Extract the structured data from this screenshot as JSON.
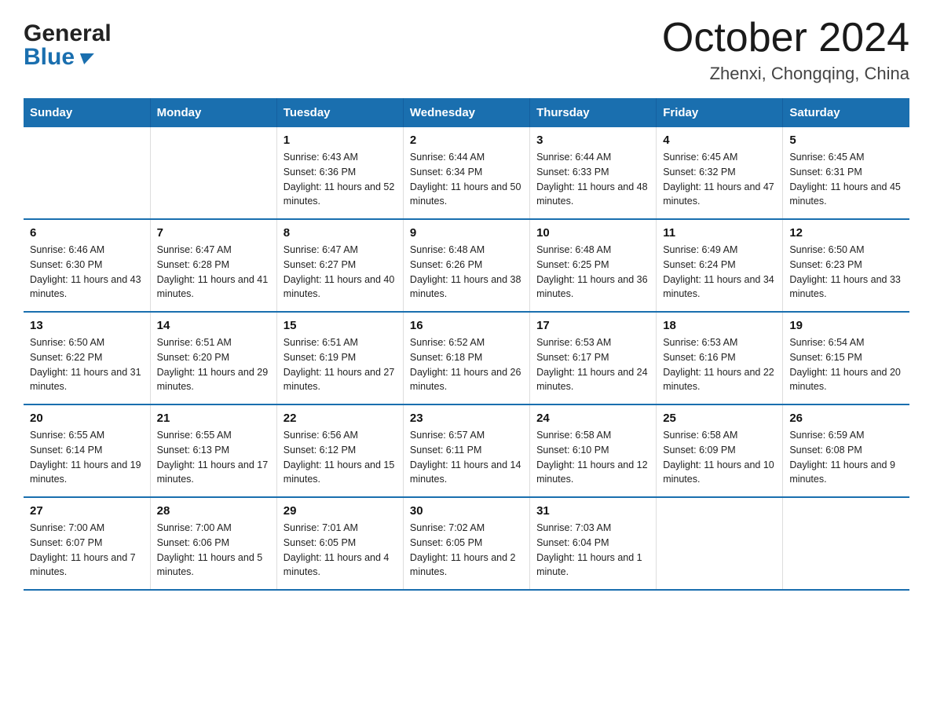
{
  "logo": {
    "line1": "General",
    "line2": "Blue"
  },
  "title": "October 2024",
  "subtitle": "Zhenxi, Chongqing, China",
  "weekdays": [
    "Sunday",
    "Monday",
    "Tuesday",
    "Wednesday",
    "Thursday",
    "Friday",
    "Saturday"
  ],
  "weeks": [
    [
      {
        "day": "",
        "sunrise": "",
        "sunset": "",
        "daylight": ""
      },
      {
        "day": "",
        "sunrise": "",
        "sunset": "",
        "daylight": ""
      },
      {
        "day": "1",
        "sunrise": "Sunrise: 6:43 AM",
        "sunset": "Sunset: 6:36 PM",
        "daylight": "Daylight: 11 hours and 52 minutes."
      },
      {
        "day": "2",
        "sunrise": "Sunrise: 6:44 AM",
        "sunset": "Sunset: 6:34 PM",
        "daylight": "Daylight: 11 hours and 50 minutes."
      },
      {
        "day": "3",
        "sunrise": "Sunrise: 6:44 AM",
        "sunset": "Sunset: 6:33 PM",
        "daylight": "Daylight: 11 hours and 48 minutes."
      },
      {
        "day": "4",
        "sunrise": "Sunrise: 6:45 AM",
        "sunset": "Sunset: 6:32 PM",
        "daylight": "Daylight: 11 hours and 47 minutes."
      },
      {
        "day": "5",
        "sunrise": "Sunrise: 6:45 AM",
        "sunset": "Sunset: 6:31 PM",
        "daylight": "Daylight: 11 hours and 45 minutes."
      }
    ],
    [
      {
        "day": "6",
        "sunrise": "Sunrise: 6:46 AM",
        "sunset": "Sunset: 6:30 PM",
        "daylight": "Daylight: 11 hours and 43 minutes."
      },
      {
        "day": "7",
        "sunrise": "Sunrise: 6:47 AM",
        "sunset": "Sunset: 6:28 PM",
        "daylight": "Daylight: 11 hours and 41 minutes."
      },
      {
        "day": "8",
        "sunrise": "Sunrise: 6:47 AM",
        "sunset": "Sunset: 6:27 PM",
        "daylight": "Daylight: 11 hours and 40 minutes."
      },
      {
        "day": "9",
        "sunrise": "Sunrise: 6:48 AM",
        "sunset": "Sunset: 6:26 PM",
        "daylight": "Daylight: 11 hours and 38 minutes."
      },
      {
        "day": "10",
        "sunrise": "Sunrise: 6:48 AM",
        "sunset": "Sunset: 6:25 PM",
        "daylight": "Daylight: 11 hours and 36 minutes."
      },
      {
        "day": "11",
        "sunrise": "Sunrise: 6:49 AM",
        "sunset": "Sunset: 6:24 PM",
        "daylight": "Daylight: 11 hours and 34 minutes."
      },
      {
        "day": "12",
        "sunrise": "Sunrise: 6:50 AM",
        "sunset": "Sunset: 6:23 PM",
        "daylight": "Daylight: 11 hours and 33 minutes."
      }
    ],
    [
      {
        "day": "13",
        "sunrise": "Sunrise: 6:50 AM",
        "sunset": "Sunset: 6:22 PM",
        "daylight": "Daylight: 11 hours and 31 minutes."
      },
      {
        "day": "14",
        "sunrise": "Sunrise: 6:51 AM",
        "sunset": "Sunset: 6:20 PM",
        "daylight": "Daylight: 11 hours and 29 minutes."
      },
      {
        "day": "15",
        "sunrise": "Sunrise: 6:51 AM",
        "sunset": "Sunset: 6:19 PM",
        "daylight": "Daylight: 11 hours and 27 minutes."
      },
      {
        "day": "16",
        "sunrise": "Sunrise: 6:52 AM",
        "sunset": "Sunset: 6:18 PM",
        "daylight": "Daylight: 11 hours and 26 minutes."
      },
      {
        "day": "17",
        "sunrise": "Sunrise: 6:53 AM",
        "sunset": "Sunset: 6:17 PM",
        "daylight": "Daylight: 11 hours and 24 minutes."
      },
      {
        "day": "18",
        "sunrise": "Sunrise: 6:53 AM",
        "sunset": "Sunset: 6:16 PM",
        "daylight": "Daylight: 11 hours and 22 minutes."
      },
      {
        "day": "19",
        "sunrise": "Sunrise: 6:54 AM",
        "sunset": "Sunset: 6:15 PM",
        "daylight": "Daylight: 11 hours and 20 minutes."
      }
    ],
    [
      {
        "day": "20",
        "sunrise": "Sunrise: 6:55 AM",
        "sunset": "Sunset: 6:14 PM",
        "daylight": "Daylight: 11 hours and 19 minutes."
      },
      {
        "day": "21",
        "sunrise": "Sunrise: 6:55 AM",
        "sunset": "Sunset: 6:13 PM",
        "daylight": "Daylight: 11 hours and 17 minutes."
      },
      {
        "day": "22",
        "sunrise": "Sunrise: 6:56 AM",
        "sunset": "Sunset: 6:12 PM",
        "daylight": "Daylight: 11 hours and 15 minutes."
      },
      {
        "day": "23",
        "sunrise": "Sunrise: 6:57 AM",
        "sunset": "Sunset: 6:11 PM",
        "daylight": "Daylight: 11 hours and 14 minutes."
      },
      {
        "day": "24",
        "sunrise": "Sunrise: 6:58 AM",
        "sunset": "Sunset: 6:10 PM",
        "daylight": "Daylight: 11 hours and 12 minutes."
      },
      {
        "day": "25",
        "sunrise": "Sunrise: 6:58 AM",
        "sunset": "Sunset: 6:09 PM",
        "daylight": "Daylight: 11 hours and 10 minutes."
      },
      {
        "day": "26",
        "sunrise": "Sunrise: 6:59 AM",
        "sunset": "Sunset: 6:08 PM",
        "daylight": "Daylight: 11 hours and 9 minutes."
      }
    ],
    [
      {
        "day": "27",
        "sunrise": "Sunrise: 7:00 AM",
        "sunset": "Sunset: 6:07 PM",
        "daylight": "Daylight: 11 hours and 7 minutes."
      },
      {
        "day": "28",
        "sunrise": "Sunrise: 7:00 AM",
        "sunset": "Sunset: 6:06 PM",
        "daylight": "Daylight: 11 hours and 5 minutes."
      },
      {
        "day": "29",
        "sunrise": "Sunrise: 7:01 AM",
        "sunset": "Sunset: 6:05 PM",
        "daylight": "Daylight: 11 hours and 4 minutes."
      },
      {
        "day": "30",
        "sunrise": "Sunrise: 7:02 AM",
        "sunset": "Sunset: 6:05 PM",
        "daylight": "Daylight: 11 hours and 2 minutes."
      },
      {
        "day": "31",
        "sunrise": "Sunrise: 7:03 AM",
        "sunset": "Sunset: 6:04 PM",
        "daylight": "Daylight: 11 hours and 1 minute."
      },
      {
        "day": "",
        "sunrise": "",
        "sunset": "",
        "daylight": ""
      },
      {
        "day": "",
        "sunrise": "",
        "sunset": "",
        "daylight": ""
      }
    ]
  ]
}
